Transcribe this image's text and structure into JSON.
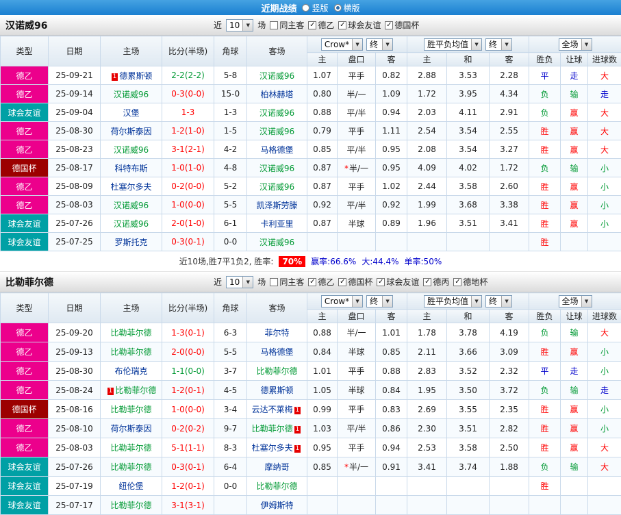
{
  "top_bar": {
    "title": "近期战绩",
    "layout_options": [
      {
        "label": "竖版",
        "selected": false
      },
      {
        "label": "横版",
        "selected": true
      }
    ]
  },
  "colors": {
    "topbar_bg": "#1a7fd0",
    "league_de2": "#ec008c",
    "league_friendly": "#00a0a5",
    "league_cup": "#9c0000",
    "team_self": "#009933",
    "team_opp": "#003399",
    "win_red": "#ff0000",
    "draw_green": "#009933",
    "neutral_blue": "#0000cc",
    "rate_badge_bg": "#ff0000",
    "header_bg": "#dfe9f2",
    "grid_border": "#c9d9ea"
  },
  "sections": [
    {
      "team": "汉诺威96",
      "filter": {
        "prefix": "近",
        "count": "10",
        "suffix": "场",
        "checkboxes": [
          {
            "label": "同主客",
            "checked": false
          },
          {
            "label": "德乙",
            "checked": true
          },
          {
            "label": "球会友谊",
            "checked": true
          },
          {
            "label": "德国杯",
            "checked": true
          }
        ]
      },
      "header": {
        "columns": [
          "类型",
          "日期",
          "主场",
          "比分(半场)",
          "角球",
          "客场"
        ],
        "odds_select": "Crow*",
        "odds_final_select": "终",
        "odds_cols": [
          "主",
          "盘口",
          "客"
        ],
        "avg_select": "胜平负均值",
        "avg_final_select": "终",
        "avg_cols": [
          "主",
          "和",
          "客"
        ],
        "full_select": "全场",
        "result_cols": [
          "胜负",
          "让球",
          "进球数"
        ]
      },
      "rows": [
        {
          "type": "德乙",
          "date": "25-09-21",
          "home": "德累斯顿",
          "home_badge": "1",
          "score": "2-2(2-2)",
          "corner": "5-8",
          "away": "汉诺威96",
          "odds_home": "1.07",
          "handicap": "平手",
          "odds_away": "0.82",
          "avg_home": "2.88",
          "avg_draw": "3.53",
          "avg_away": "2.28",
          "result": "平",
          "handicap_result": "走",
          "goals_result": "大"
        },
        {
          "type": "德乙",
          "date": "25-09-14",
          "home": "汉诺威96",
          "score": "0-3(0-0)",
          "corner": "15-0",
          "away": "柏林赫塔",
          "odds_home": "0.80",
          "handicap": "半/一",
          "odds_away": "1.09",
          "avg_home": "1.72",
          "avg_draw": "3.95",
          "avg_away": "4.34",
          "result": "负",
          "handicap_result": "输",
          "goals_result": "走"
        },
        {
          "type": "球会友谊",
          "date": "25-09-04",
          "home": "汉堡",
          "score": "1-3",
          "corner": "1-3",
          "away": "汉诺威96",
          "odds_home": "0.88",
          "handicap": "平/半",
          "odds_away": "0.94",
          "avg_home": "2.03",
          "avg_draw": "4.11",
          "avg_away": "2.91",
          "result": "负",
          "handicap_result": "赢",
          "goals_result": "大"
        },
        {
          "type": "德乙",
          "date": "25-08-30",
          "home": "荷尔斯泰因",
          "score": "1-2(1-0)",
          "corner": "1-5",
          "away": "汉诺威96",
          "odds_home": "0.79",
          "handicap": "平手",
          "odds_away": "1.11",
          "avg_home": "2.54",
          "avg_draw": "3.54",
          "avg_away": "2.55",
          "result": "胜",
          "handicap_result": "赢",
          "goals_result": "大"
        },
        {
          "type": "德乙",
          "date": "25-08-23",
          "home": "汉诺威96",
          "score": "3-1(2-1)",
          "corner": "4-2",
          "away": "马格德堡",
          "odds_home": "0.85",
          "handicap": "平/半",
          "odds_away": "0.95",
          "avg_home": "2.08",
          "avg_draw": "3.54",
          "avg_away": "3.27",
          "result": "胜",
          "handicap_result": "赢",
          "goals_result": "大"
        },
        {
          "type": "德国杯",
          "date": "25-08-17",
          "home": "科特布斯",
          "score": "1-0(1-0)",
          "corner": "4-8",
          "away": "汉诺威96",
          "odds_home": "0.87",
          "handicap": "半/一",
          "handicap_star": true,
          "odds_away": "0.95",
          "avg_home": "4.09",
          "avg_draw": "4.02",
          "avg_away": "1.72",
          "result": "负",
          "handicap_result": "输",
          "goals_result": "小"
        },
        {
          "type": "德乙",
          "date": "25-08-09",
          "home": "杜塞尔多夫",
          "score": "0-2(0-0)",
          "corner": "5-2",
          "away": "汉诺威96",
          "odds_home": "0.87",
          "handicap": "平手",
          "odds_away": "1.02",
          "avg_home": "2.44",
          "avg_draw": "3.58",
          "avg_away": "2.60",
          "result": "胜",
          "handicap_result": "赢",
          "goals_result": "小"
        },
        {
          "type": "德乙",
          "date": "25-08-03",
          "home": "汉诺威96",
          "score": "1-0(0-0)",
          "corner": "5-5",
          "away": "凯泽斯劳滕",
          "odds_home": "0.92",
          "handicap": "平/半",
          "odds_away": "0.92",
          "avg_home": "1.99",
          "avg_draw": "3.68",
          "avg_away": "3.38",
          "result": "胜",
          "handicap_result": "赢",
          "goals_result": "小"
        },
        {
          "type": "球会友谊",
          "date": "25-07-26",
          "home": "汉诺威96",
          "score": "2-0(1-0)",
          "corner": "6-1",
          "away": "卡利亚里",
          "odds_home": "0.87",
          "handicap": "半球",
          "odds_away": "0.89",
          "avg_home": "1.96",
          "avg_draw": "3.51",
          "avg_away": "3.41",
          "result": "胜",
          "handicap_result": "赢",
          "goals_result": "小"
        },
        {
          "type": "球会友谊",
          "date": "25-07-25",
          "home": "罗斯托克",
          "score": "0-3(0-1)",
          "corner": "0-0",
          "away": "汉诺威96",
          "odds_home": "",
          "handicap": "",
          "odds_away": "",
          "avg_home": "",
          "avg_draw": "",
          "avg_away": "",
          "result": "胜",
          "handicap_result": "",
          "goals_result": ""
        }
      ],
      "summary": {
        "lead": "近10场,胜7平1负2, 胜率:",
        "win_rate": "70%",
        "stats": [
          "赢率:66.6%",
          "大:44.4%",
          "单率:50%"
        ]
      }
    },
    {
      "team": "比勒菲尔德",
      "filter": {
        "prefix": "近",
        "count": "10",
        "suffix": "场",
        "checkboxes": [
          {
            "label": "同主客",
            "checked": false
          },
          {
            "label": "德乙",
            "checked": true
          },
          {
            "label": "德国杯",
            "checked": true
          },
          {
            "label": "球会友谊",
            "checked": true
          },
          {
            "label": "德丙",
            "checked": true
          },
          {
            "label": "德地杯",
            "checked": true
          }
        ]
      },
      "header": {
        "columns": [
          "类型",
          "日期",
          "主场",
          "比分(半场)",
          "角球",
          "客场"
        ],
        "odds_select": "Crow*",
        "odds_final_select": "终",
        "odds_cols": [
          "主",
          "盘口",
          "客"
        ],
        "avg_select": "胜平负均值",
        "avg_final_select": "终",
        "avg_cols": [
          "主",
          "和",
          "客"
        ],
        "full_select": "全场",
        "result_cols": [
          "胜负",
          "让球",
          "进球数"
        ]
      },
      "rows": [
        {
          "type": "德乙",
          "date": "25-09-20",
          "home": "比勒菲尔德",
          "score": "1-3(0-1)",
          "corner": "6-3",
          "away": "菲尔特",
          "odds_home": "0.88",
          "handicap": "半/一",
          "odds_away": "1.01",
          "avg_home": "1.78",
          "avg_draw": "3.78",
          "avg_away": "4.19",
          "result": "负",
          "handicap_result": "输",
          "goals_result": "大"
        },
        {
          "type": "德乙",
          "date": "25-09-13",
          "home": "比勒菲尔德",
          "score": "2-0(0-0)",
          "corner": "5-5",
          "away": "马格德堡",
          "odds_home": "0.84",
          "handicap": "半球",
          "odds_away": "0.85",
          "avg_home": "2.11",
          "avg_draw": "3.66",
          "avg_away": "3.09",
          "result": "胜",
          "handicap_result": "赢",
          "goals_result": "小"
        },
        {
          "type": "德乙",
          "date": "25-08-30",
          "home": "布伦瑞克",
          "score": "1-1(0-0)",
          "corner": "3-7",
          "away": "比勒菲尔德",
          "odds_home": "1.01",
          "handicap": "平手",
          "odds_away": "0.88",
          "avg_home": "2.83",
          "avg_draw": "3.52",
          "avg_away": "2.32",
          "result": "平",
          "handicap_result": "走",
          "goals_result": "小"
        },
        {
          "type": "德乙",
          "date": "25-08-24",
          "home": "比勒菲尔德",
          "home_badge": "1",
          "score": "1-2(0-1)",
          "corner": "4-5",
          "away": "德累斯顿",
          "odds_home": "1.05",
          "handicap": "半球",
          "odds_away": "0.84",
          "avg_home": "1.95",
          "avg_draw": "3.50",
          "avg_away": "3.72",
          "result": "负",
          "handicap_result": "输",
          "goals_result": "走"
        },
        {
          "type": "德国杯",
          "date": "25-08-16",
          "home": "比勒菲尔德",
          "score": "1-0(0-0)",
          "corner": "3-4",
          "away": "云达不莱梅",
          "away_badge": "1",
          "odds_home": "0.99",
          "handicap": "平手",
          "odds_away": "0.83",
          "avg_home": "2.69",
          "avg_draw": "3.55",
          "avg_away": "2.35",
          "result": "胜",
          "handicap_result": "赢",
          "goals_result": "小"
        },
        {
          "type": "德乙",
          "date": "25-08-10",
          "home": "荷尔斯泰因",
          "score": "0-2(0-2)",
          "corner": "9-7",
          "away": "比勒菲尔德",
          "away_badge": "1",
          "odds_home": "1.03",
          "handicap": "平/半",
          "odds_away": "0.86",
          "avg_home": "2.30",
          "avg_draw": "3.51",
          "avg_away": "2.82",
          "result": "胜",
          "handicap_result": "赢",
          "goals_result": "小"
        },
        {
          "type": "德乙",
          "date": "25-08-03",
          "home": "比勒菲尔德",
          "score": "5-1(1-1)",
          "corner": "8-3",
          "away": "杜塞尔多夫",
          "away_badge": "1",
          "odds_home": "0.95",
          "handicap": "平手",
          "odds_away": "0.94",
          "avg_home": "2.53",
          "avg_draw": "3.58",
          "avg_away": "2.50",
          "result": "胜",
          "handicap_result": "赢",
          "goals_result": "大"
        },
        {
          "type": "球会友谊",
          "date": "25-07-26",
          "home": "比勒菲尔德",
          "score": "0-3(0-1)",
          "corner": "6-4",
          "away": "摩纳哥",
          "odds_home": "0.85",
          "handicap": "半/一",
          "handicap_star": true,
          "odds_away": "0.91",
          "avg_home": "3.41",
          "avg_draw": "3.74",
          "avg_away": "1.88",
          "result": "负",
          "handicap_result": "输",
          "goals_result": "大"
        },
        {
          "type": "球会友谊",
          "date": "25-07-19",
          "home": "纽伦堡",
          "score": "1-2(0-1)",
          "corner": "0-0",
          "away": "比勒菲尔德",
          "odds_home": "",
          "handicap": "",
          "odds_away": "",
          "avg_home": "",
          "avg_draw": "",
          "avg_away": "",
          "result": "胜",
          "handicap_result": "",
          "goals_result": ""
        },
        {
          "type": "球会友谊",
          "date": "25-07-17",
          "home": "比勒菲尔德",
          "score": "3-1(3-1)",
          "corner": "",
          "away": "伊姆斯特",
          "odds_home": "",
          "handicap": "",
          "odds_away": "",
          "avg_home": "",
          "avg_draw": "",
          "avg_away": "",
          "result": "",
          "handicap_result": "",
          "goals_result": ""
        }
      ]
    }
  ]
}
